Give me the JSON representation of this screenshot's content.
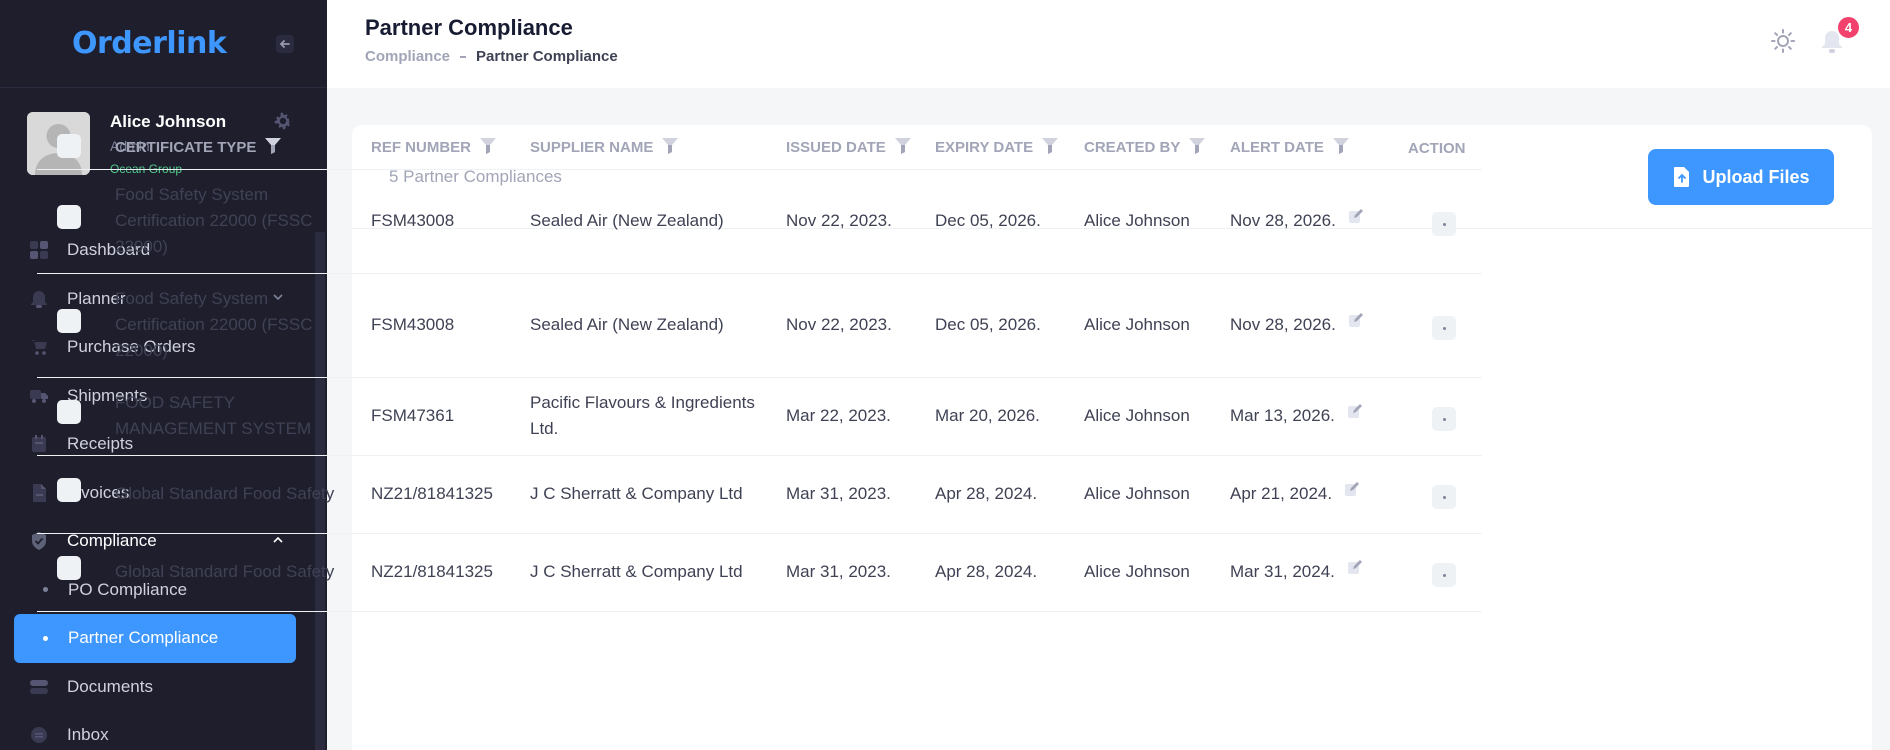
{
  "app": {
    "logo": "Orderlink"
  },
  "user": {
    "name": "Alice Johnson",
    "role": "Admin",
    "org": "Ocean Group"
  },
  "sidebar": {
    "items": [
      {
        "label": "Dashboard"
      },
      {
        "label": "Planner"
      },
      {
        "label": "Purchase Orders"
      },
      {
        "label": "Shipments"
      },
      {
        "label": "Receipts"
      },
      {
        "label": "Invoices"
      },
      {
        "label": "Compliance"
      },
      {
        "label": "PO Compliance"
      },
      {
        "label": "Partner Compliance"
      },
      {
        "label": "Documents"
      },
      {
        "label": "Inbox"
      }
    ]
  },
  "header": {
    "title": "Partner Compliance",
    "breadcrumb_parent": "Compliance",
    "breadcrumb_current": "Partner Compliance",
    "notification_count": "4"
  },
  "card": {
    "count_label": "5 Partner Compliances",
    "upload_label": "Upload Files"
  },
  "table": {
    "columns": [
      "CERTIFICATE TYPE",
      "REF NUMBER",
      "SUPPLIER NAME",
      "ISSUED DATE",
      "EXPIRY DATE",
      "CREATED BY",
      "ALERT DATE",
      "ACTION"
    ],
    "rows": [
      {
        "cert": "Food Safety System Certification 22000 (FSSC 22000)",
        "ref": "FSM43008",
        "supplier": "Sealed Air (New Zealand)",
        "issued": "Nov 22, 2023.",
        "expiry": "Dec 05, 2026.",
        "created": "Alice Johnson",
        "alert": "Nov 28, 2026."
      },
      {
        "cert": "Food Safety System Certification 22000 (FSSC 22000)",
        "ref": "FSM43008",
        "supplier": "Sealed Air (New Zealand)",
        "issued": "Nov 22, 2023.",
        "expiry": "Dec 05, 2026.",
        "created": "Alice Johnson",
        "alert": "Nov 28, 2026."
      },
      {
        "cert": "FOOD SAFETY MANAGEMENT SYSTEM",
        "ref": "FSM47361",
        "supplier": "Pacific Flavours & Ingredients Ltd.",
        "issued": "Mar 22, 2023.",
        "expiry": "Mar 20, 2026.",
        "created": "Alice Johnson",
        "alert": "Mar 13, 2026."
      },
      {
        "cert": "Global Standard Food Safety",
        "ref": "NZ21/81841325",
        "supplier": "J C Sherratt & Company Ltd",
        "issued": "Mar 31, 2023.",
        "expiry": "Apr 28, 2024.",
        "created": "Alice Johnson",
        "alert": "Apr 21, 2024."
      },
      {
        "cert": "Global Standard Food Safety",
        "ref": "NZ21/81841325",
        "supplier": "J C Sherratt & Company Ltd",
        "issued": "Mar 31, 2023.",
        "expiry": "Apr 28, 2024.",
        "created": "Alice Johnson",
        "alert": "Mar 31, 2024."
      }
    ]
  },
  "colors": {
    "accent": "#3e97ff",
    "sidebar_bg": "#1e1e2d",
    "badge": "#f1416c"
  }
}
